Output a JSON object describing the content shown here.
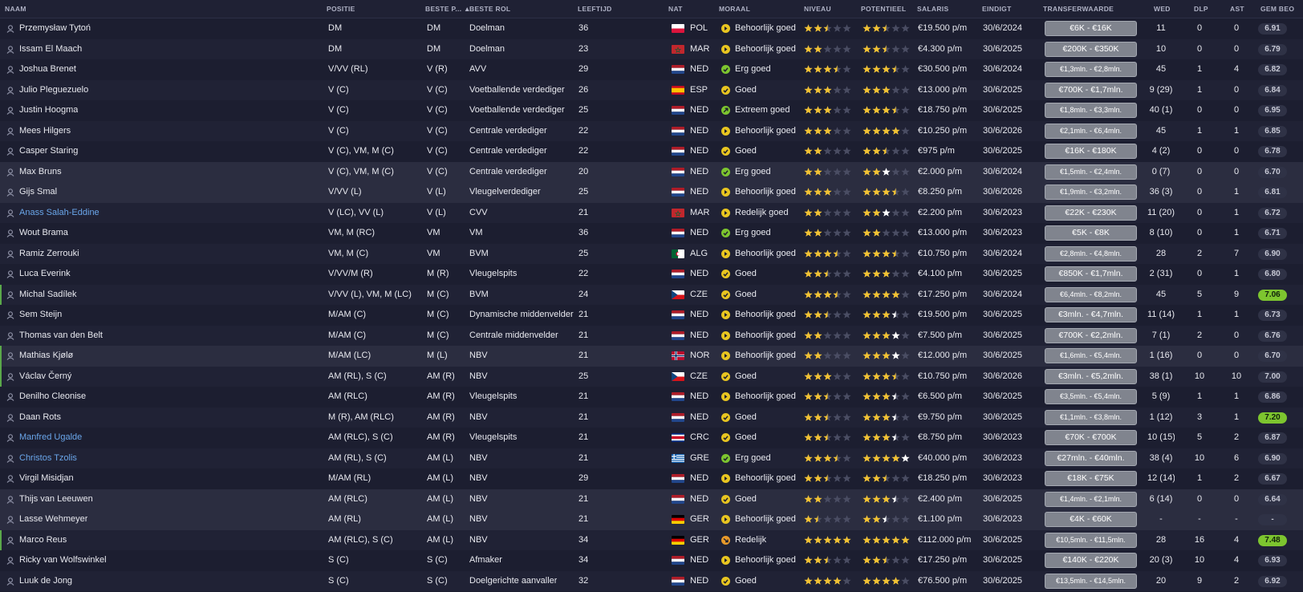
{
  "headers": {
    "naam": "NAAM",
    "positie": "POSITIE",
    "beste_p": "BESTE P...",
    "beste_rol": "BESTE ROL",
    "leeftijd": "LEEFTIJD",
    "nat": "NAT",
    "moraal": "MORAAL",
    "niveau": "NIVEAU",
    "potentieel": "POTENTIEEL",
    "salaris": "SALARIS",
    "eindigt": "EINDIGT",
    "transferwaarde": "TRANSFERWAARDE",
    "wed": "WED",
    "dlp": "DLP",
    "ast": "AST",
    "gem_beo": "GEM BEO"
  },
  "colors": {
    "star": "#f2c233",
    "star_empty": "#4a4d63",
    "star_white": "#ffffff",
    "rating_good": "#7dc52f",
    "link_name": "#6aa6ea",
    "morale_green": "#7dc52f",
    "morale_yellow": "#e8c520",
    "morale_orange": "#e89a2a"
  },
  "players": [
    {
      "name": "Przemysław Tytoń",
      "pos": "DM",
      "best_pos": "DM",
      "role": "Doelman",
      "age": "36",
      "flag": "POL",
      "nat": "POL",
      "morale": "Behoorlijk goed",
      "morale_icon": "yellow-arrow",
      "ability": 2.5,
      "potential": 2.5,
      "pot_white": 0,
      "salary": "€19.500 p/m",
      "expires": "30/6/2024",
      "value": "€6K - €16K",
      "apps": "11",
      "goals": "0",
      "assists": "0",
      "rating": "6.91",
      "rating_good": false,
      "link": false,
      "edge": "none",
      "hl": false
    },
    {
      "name": "Issam El Maach",
      "pos": "DM",
      "best_pos": "DM",
      "role": "Doelman",
      "age": "23",
      "flag": "MAR",
      "nat": "MAR",
      "morale": "Behoorlijk goed",
      "morale_icon": "yellow-arrow",
      "ability": 2,
      "potential": 2.5,
      "pot_white": 0,
      "salary": "€4.300 p/m",
      "expires": "30/6/2025",
      "value": "€200K - €350K",
      "apps": "10",
      "goals": "0",
      "assists": "0",
      "rating": "6.79",
      "rating_good": false,
      "link": false,
      "edge": "none",
      "hl": false
    },
    {
      "name": "Joshua Brenet",
      "pos": "V/VV (RL)",
      "best_pos": "V (R)",
      "role": "AVV",
      "age": "29",
      "flag": "NED",
      "nat": "NED",
      "morale": "Erg goed",
      "morale_icon": "green-check",
      "ability": 3.5,
      "potential": 3.5,
      "pot_white": 0,
      "salary": "€30.500 p/m",
      "expires": "30/6/2024",
      "value": "€1,3mln. - €2,8mln.",
      "apps": "45",
      "goals": "1",
      "assists": "4",
      "rating": "6.82",
      "rating_good": false,
      "link": false,
      "edge": "none",
      "hl": false
    },
    {
      "name": "Julio Pleguezuelo",
      "pos": "V (C)",
      "best_pos": "V (C)",
      "role": "Voetballende verdediger",
      "age": "26",
      "flag": "ESP",
      "nat": "ESP",
      "morale": "Goed",
      "morale_icon": "yellow-check",
      "ability": 3,
      "potential": 3,
      "pot_white": 0,
      "salary": "€13.000 p/m",
      "expires": "30/6/2025",
      "value": "€700K - €1,7mln.",
      "apps": "9 (29)",
      "goals": "1",
      "assists": "0",
      "rating": "6.84",
      "rating_good": false,
      "link": false,
      "edge": "none",
      "hl": false
    },
    {
      "name": "Justin Hoogma",
      "pos": "V (C)",
      "best_pos": "V (C)",
      "role": "Voetballende verdediger",
      "age": "25",
      "flag": "NED",
      "nat": "NED",
      "morale": "Extreem goed",
      "morale_icon": "green-up",
      "ability": 3,
      "potential": 3.5,
      "pot_white": 0,
      "salary": "€18.750 p/m",
      "expires": "30/6/2025",
      "value": "€1,8mln. - €3,3mln.",
      "apps": "40 (1)",
      "goals": "0",
      "assists": "0",
      "rating": "6.95",
      "rating_good": false,
      "link": false,
      "edge": "none",
      "hl": false
    },
    {
      "name": "Mees Hilgers",
      "pos": "V (C)",
      "best_pos": "V (C)",
      "role": "Centrale verdediger",
      "age": "22",
      "flag": "NED",
      "nat": "NED",
      "morale": "Behoorlijk goed",
      "morale_icon": "yellow-arrow",
      "ability": 3,
      "potential": 4,
      "pot_white": 0,
      "salary": "€10.250 p/m",
      "expires": "30/6/2026",
      "value": "€2,1mln. - €6,4mln.",
      "apps": "45",
      "goals": "1",
      "assists": "1",
      "rating": "6.85",
      "rating_good": false,
      "link": false,
      "edge": "none",
      "hl": false
    },
    {
      "name": "Casper Staring",
      "pos": "V (C), VM, M (C)",
      "best_pos": "V (C)",
      "role": "Centrale verdediger",
      "age": "22",
      "flag": "NED",
      "nat": "NED",
      "morale": "Goed",
      "morale_icon": "yellow-check",
      "ability": 2,
      "potential": 2.5,
      "pot_white": 0,
      "salary": "€975 p/m",
      "expires": "30/6/2025",
      "value": "€16K - €180K",
      "apps": "4 (2)",
      "goals": "0",
      "assists": "0",
      "rating": "6.78",
      "rating_good": false,
      "link": false,
      "edge": "none",
      "hl": false
    },
    {
      "name": "Max Bruns",
      "pos": "V (C), VM, M (C)",
      "best_pos": "V (C)",
      "role": "Centrale verdediger",
      "age": "20",
      "flag": "NED",
      "nat": "NED",
      "morale": "Erg goed",
      "morale_icon": "green-check",
      "ability": 2,
      "potential": 2,
      "pot_white": 1,
      "salary": "€2.000 p/m",
      "expires": "30/6/2024",
      "value": "€1,5mln. - €2,4mln.",
      "apps": "0 (7)",
      "goals": "0",
      "assists": "0",
      "rating": "6.70",
      "rating_good": false,
      "link": false,
      "edge": "none",
      "hl": true
    },
    {
      "name": "Gijs Smal",
      "pos": "V/VV (L)",
      "best_pos": "V (L)",
      "role": "Vleugelverdediger",
      "age": "25",
      "flag": "NED",
      "nat": "NED",
      "morale": "Behoorlijk goed",
      "morale_icon": "yellow-arrow",
      "ability": 3,
      "potential": 3.5,
      "pot_white": 0,
      "salary": "€8.250 p/m",
      "expires": "30/6/2026",
      "value": "€1,9mln. - €3,2mln.",
      "apps": "36 (3)",
      "goals": "0",
      "assists": "1",
      "rating": "6.81",
      "rating_good": false,
      "link": false,
      "edge": "none",
      "hl": true
    },
    {
      "name": "Anass Salah-Eddine",
      "pos": "V (LC), VV (L)",
      "best_pos": "V (L)",
      "role": "CVV",
      "age": "21",
      "flag": "MAR",
      "nat": "MAR",
      "morale": "Redelijk goed",
      "morale_icon": "yellow-arrow",
      "ability": 2,
      "potential": 2,
      "pot_white": 1,
      "salary": "€2.200 p/m",
      "expires": "30/6/2023",
      "value": "€22K - €230K",
      "apps": "11 (20)",
      "goals": "0",
      "assists": "1",
      "rating": "6.72",
      "rating_good": false,
      "link": true,
      "edge": "none",
      "hl": false
    },
    {
      "name": "Wout Brama",
      "pos": "VM, M (RC)",
      "best_pos": "VM",
      "role": "VM",
      "age": "36",
      "flag": "NED",
      "nat": "NED",
      "morale": "Erg goed",
      "morale_icon": "green-check",
      "ability": 2,
      "potential": 2,
      "pot_white": 0,
      "salary": "€13.000 p/m",
      "expires": "30/6/2023",
      "value": "€5K - €8K",
      "apps": "8 (10)",
      "goals": "0",
      "assists": "1",
      "rating": "6.71",
      "rating_good": false,
      "link": false,
      "edge": "none",
      "hl": false
    },
    {
      "name": "Ramiz Zerrouki",
      "pos": "VM, M (C)",
      "best_pos": "VM",
      "role": "BVM",
      "age": "25",
      "flag": "ALG",
      "nat": "ALG",
      "morale": "Behoorlijk goed",
      "morale_icon": "yellow-arrow",
      "ability": 3.5,
      "potential": 3.5,
      "pot_white": 0,
      "salary": "€10.750 p/m",
      "expires": "30/6/2024",
      "value": "€2,8mln. - €4,8mln.",
      "apps": "28",
      "goals": "2",
      "assists": "7",
      "rating": "6.90",
      "rating_good": false,
      "link": false,
      "edge": "none",
      "hl": false
    },
    {
      "name": "Luca Everink",
      "pos": "V/VV/M (R)",
      "best_pos": "M (R)",
      "role": "Vleugelspits",
      "age": "22",
      "flag": "NED",
      "nat": "NED",
      "morale": "Goed",
      "morale_icon": "yellow-check",
      "ability": 2.5,
      "potential": 3,
      "pot_white": 0,
      "salary": "€4.100 p/m",
      "expires": "30/6/2025",
      "value": "€850K - €1,7mln.",
      "apps": "2 (31)",
      "goals": "0",
      "assists": "1",
      "rating": "6.80",
      "rating_good": false,
      "link": false,
      "edge": "none",
      "hl": false
    },
    {
      "name": "Michal Sadílek",
      "pos": "V/VV (L), VM, M (LC)",
      "best_pos": "M (C)",
      "role": "BVM",
      "age": "24",
      "flag": "CZE",
      "nat": "CZE",
      "morale": "Goed",
      "morale_icon": "yellow-check",
      "ability": 3.5,
      "potential": 4,
      "pot_white": 0,
      "salary": "€17.250 p/m",
      "expires": "30/6/2024",
      "value": "€6,4mln. - €8,2mln.",
      "apps": "45",
      "goals": "5",
      "assists": "9",
      "rating": "7.06",
      "rating_good": true,
      "link": false,
      "edge": "green",
      "hl": false
    },
    {
      "name": "Sem Steijn",
      "pos": "M/AM (C)",
      "best_pos": "M (C)",
      "role": "Dynamische middenvelder",
      "age": "21",
      "flag": "NED",
      "nat": "NED",
      "morale": "Behoorlijk goed",
      "morale_icon": "yellow-arrow",
      "ability": 2.5,
      "potential": 3,
      "pot_white": 0.5,
      "salary": "€19.500 p/m",
      "expires": "30/6/2025",
      "value": "€3mln. - €4,7mln.",
      "apps": "11 (14)",
      "goals": "1",
      "assists": "1",
      "rating": "6.73",
      "rating_good": false,
      "link": false,
      "edge": "none",
      "hl": false
    },
    {
      "name": "Thomas van den Belt",
      "pos": "M/AM (C)",
      "best_pos": "M (C)",
      "role": "Centrale middenvelder",
      "age": "21",
      "flag": "NED",
      "nat": "NED",
      "morale": "Behoorlijk goed",
      "morale_icon": "yellow-arrow",
      "ability": 2,
      "potential": 3,
      "pot_white": 1,
      "salary": "€7.500 p/m",
      "expires": "30/6/2025",
      "value": "€700K - €2,2mln.",
      "apps": "7 (1)",
      "goals": "2",
      "assists": "0",
      "rating": "6.76",
      "rating_good": false,
      "link": false,
      "edge": "none",
      "hl": false
    },
    {
      "name": "Mathias Kjølø",
      "pos": "M/AM (LC)",
      "best_pos": "M (L)",
      "role": "NBV",
      "age": "21",
      "flag": "NOR",
      "nat": "NOR",
      "morale": "Behoorlijk goed",
      "morale_icon": "yellow-arrow",
      "ability": 2,
      "potential": 3,
      "pot_white": 1,
      "salary": "€12.000 p/m",
      "expires": "30/6/2025",
      "value": "€1,6mln. - €5,4mln.",
      "apps": "1 (16)",
      "goals": "0",
      "assists": "0",
      "rating": "6.70",
      "rating_good": false,
      "link": false,
      "edge": "green",
      "hl": true
    },
    {
      "name": "Václav Černý",
      "pos": "AM (RL), S (C)",
      "best_pos": "AM (R)",
      "role": "NBV",
      "age": "25",
      "flag": "CZE",
      "nat": "CZE",
      "morale": "Goed",
      "morale_icon": "yellow-check",
      "ability": 3,
      "potential": 3.5,
      "pot_white": 0,
      "salary": "€10.750 p/m",
      "expires": "30/6/2026",
      "value": "€3mln. - €5,2mln.",
      "apps": "38 (1)",
      "goals": "10",
      "assists": "10",
      "rating": "7.00",
      "rating_good": false,
      "link": false,
      "edge": "green",
      "hl": false
    },
    {
      "name": "Denilho Cleonise",
      "pos": "AM (RLC)",
      "best_pos": "AM (R)",
      "role": "Vleugelspits",
      "age": "21",
      "flag": "NED",
      "nat": "NED",
      "morale": "Behoorlijk goed",
      "morale_icon": "yellow-arrow",
      "ability": 2.5,
      "potential": 3,
      "pot_white": 0.5,
      "salary": "€6.500 p/m",
      "expires": "30/6/2025",
      "value": "€3,5mln. - €5,4mln.",
      "apps": "5 (9)",
      "goals": "1",
      "assists": "1",
      "rating": "6.86",
      "rating_good": false,
      "link": false,
      "edge": "none",
      "hl": false
    },
    {
      "name": "Daan Rots",
      "pos": "M (R), AM (RLC)",
      "best_pos": "AM (R)",
      "role": "NBV",
      "age": "21",
      "flag": "NED",
      "nat": "NED",
      "morale": "Goed",
      "morale_icon": "yellow-check",
      "ability": 2.5,
      "potential": 3,
      "pot_white": 0.5,
      "salary": "€9.750 p/m",
      "expires": "30/6/2025",
      "value": "€1,1mln. - €3,8mln.",
      "apps": "1 (12)",
      "goals": "3",
      "assists": "1",
      "rating": "7.20",
      "rating_good": true,
      "link": false,
      "edge": "none",
      "hl": false
    },
    {
      "name": "Manfred Ugalde",
      "pos": "AM (RLC), S (C)",
      "best_pos": "AM (R)",
      "role": "Vleugelspits",
      "age": "21",
      "flag": "CRC",
      "nat": "CRC",
      "morale": "Goed",
      "morale_icon": "yellow-check",
      "ability": 2.5,
      "potential": 3,
      "pot_white": 0.5,
      "salary": "€8.750 p/m",
      "expires": "30/6/2023",
      "value": "€70K - €700K",
      "apps": "10 (15)",
      "goals": "5",
      "assists": "2",
      "rating": "6.87",
      "rating_good": false,
      "link": true,
      "edge": "none",
      "hl": false
    },
    {
      "name": "Christos Tzolis",
      "pos": "AM (RL), S (C)",
      "best_pos": "AM (L)",
      "role": "NBV",
      "age": "21",
      "flag": "GRE",
      "nat": "GRE",
      "morale": "Erg goed",
      "morale_icon": "green-check",
      "ability": 3.5,
      "potential": 4,
      "pot_white": 1,
      "salary": "€40.000 p/m",
      "expires": "30/6/2023",
      "value": "€27mln. - €40mln.",
      "apps": "38 (4)",
      "goals": "10",
      "assists": "6",
      "rating": "6.90",
      "rating_good": false,
      "link": true,
      "edge": "none",
      "hl": false
    },
    {
      "name": "Virgil Misidjan",
      "pos": "M/AM (RL)",
      "best_pos": "AM (L)",
      "role": "NBV",
      "age": "29",
      "flag": "NED",
      "nat": "NED",
      "morale": "Behoorlijk goed",
      "morale_icon": "yellow-arrow",
      "ability": 2.5,
      "potential": 2.5,
      "pot_white": 0,
      "salary": "€18.250 p/m",
      "expires": "30/6/2023",
      "value": "€18K - €75K",
      "apps": "12 (14)",
      "goals": "1",
      "assists": "2",
      "rating": "6.67",
      "rating_good": false,
      "link": false,
      "edge": "none",
      "hl": false
    },
    {
      "name": "Thijs van Leeuwen",
      "pos": "AM (RLC)",
      "best_pos": "AM (L)",
      "role": "NBV",
      "age": "21",
      "flag": "NED",
      "nat": "NED",
      "morale": "Goed",
      "morale_icon": "yellow-check",
      "ability": 2,
      "potential": 3,
      "pot_white": 0.5,
      "salary": "€2.400 p/m",
      "expires": "30/6/2025",
      "value": "€1,4mln. - €2,1mln.",
      "apps": "6 (14)",
      "goals": "0",
      "assists": "0",
      "rating": "6.64",
      "rating_good": false,
      "link": false,
      "edge": "none",
      "hl": true
    },
    {
      "name": "Lasse Wehmeyer",
      "pos": "AM (RL)",
      "best_pos": "AM (L)",
      "role": "NBV",
      "age": "21",
      "flag": "GER",
      "nat": "GER",
      "morale": "Behoorlijk goed",
      "morale_icon": "yellow-arrow",
      "ability": 1.5,
      "potential": 2,
      "pot_white": 0.5,
      "salary": "€1.100 p/m",
      "expires": "30/6/2023",
      "value": "€4K - €60K",
      "apps": "-",
      "goals": "-",
      "assists": "-",
      "rating": "-",
      "rating_good": false,
      "link": false,
      "edge": "none",
      "hl": true
    },
    {
      "name": "Marco Reus",
      "pos": "AM (RLC), S (C)",
      "best_pos": "AM (L)",
      "role": "NBV",
      "age": "34",
      "flag": "GER",
      "nat": "GER",
      "morale": "Redelijk",
      "morale_icon": "orange-arrow",
      "ability": 5,
      "potential": 5,
      "pot_white": 0,
      "salary": "€112.000 p/m",
      "expires": "30/6/2025",
      "value": "€10,5mln. - €11,5mln.",
      "apps": "28",
      "goals": "16",
      "assists": "4",
      "rating": "7.48",
      "rating_good": true,
      "link": false,
      "edge": "green",
      "hl": false
    },
    {
      "name": "Ricky van Wolfswinkel",
      "pos": "S (C)",
      "best_pos": "S (C)",
      "role": "Afmaker",
      "age": "34",
      "flag": "NED",
      "nat": "NED",
      "morale": "Behoorlijk goed",
      "morale_icon": "yellow-arrow",
      "ability": 2.5,
      "potential": 2.5,
      "pot_white": 0,
      "salary": "€17.250 p/m",
      "expires": "30/6/2025",
      "value": "€140K - €220K",
      "apps": "20 (3)",
      "goals": "10",
      "assists": "4",
      "rating": "6.93",
      "rating_good": false,
      "link": false,
      "edge": "none",
      "hl": false
    },
    {
      "name": "Luuk de Jong",
      "pos": "S (C)",
      "best_pos": "S (C)",
      "role": "Doelgerichte aanvaller",
      "age": "32",
      "flag": "NED",
      "nat": "NED",
      "morale": "Goed",
      "morale_icon": "yellow-check",
      "ability": 4,
      "potential": 4,
      "pot_white": 0,
      "salary": "€76.500 p/m",
      "expires": "30/6/2025",
      "value": "€13,5mln. - €14,5mln.",
      "apps": "20",
      "goals": "9",
      "assists": "2",
      "rating": "6.92",
      "rating_good": false,
      "link": false,
      "edge": "none",
      "hl": false
    }
  ]
}
